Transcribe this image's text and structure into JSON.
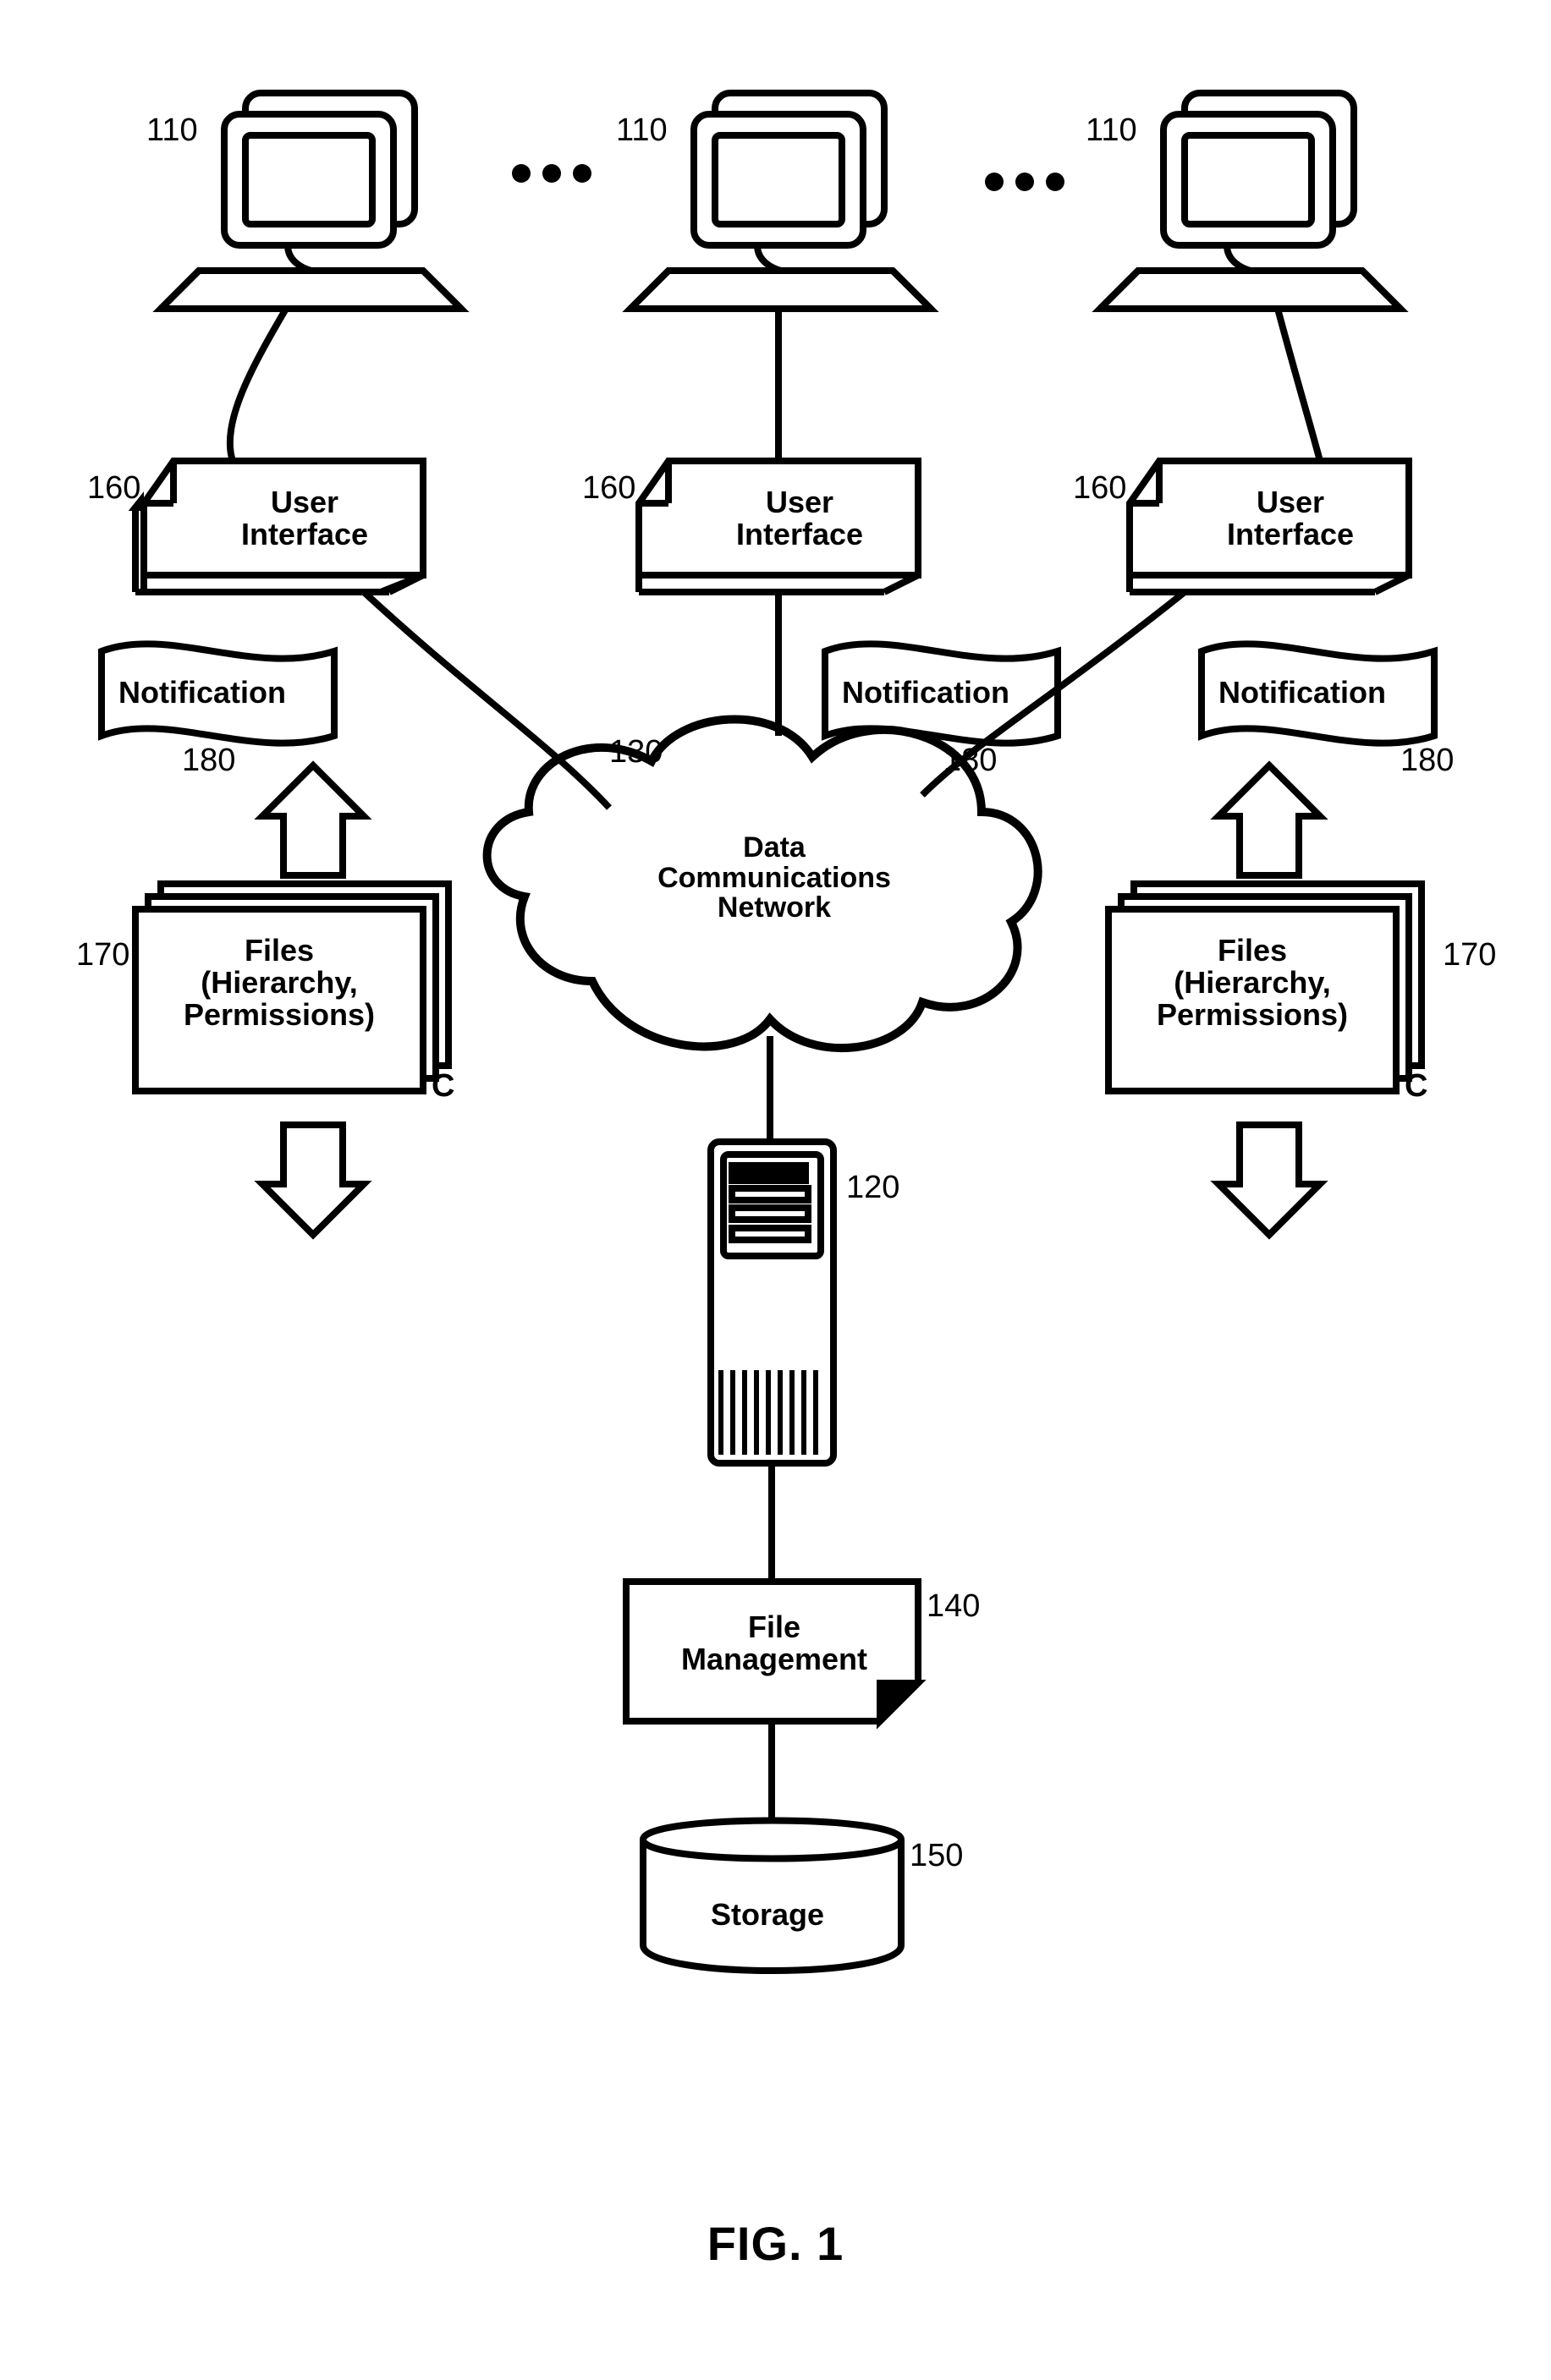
{
  "figure_caption": "FIG. 1",
  "labels": {
    "computer_ref": "110",
    "ui_ref": "160",
    "ui_text": "User\nInterface",
    "notif_ref": "180",
    "notif_text": "Notification",
    "files_ref": "170",
    "files_text": "Files\n(Hierarchy,\nPermissions)",
    "files_corner": "C",
    "cloud_ref": "130",
    "cloud_text": "Data\nCommunications\nNetwork",
    "server_ref": "120",
    "filemgmt_ref": "140",
    "filemgmt_text": "File\nManagement",
    "storage_ref": "150",
    "storage_text": "Storage",
    "ellipsis": "ooo"
  }
}
